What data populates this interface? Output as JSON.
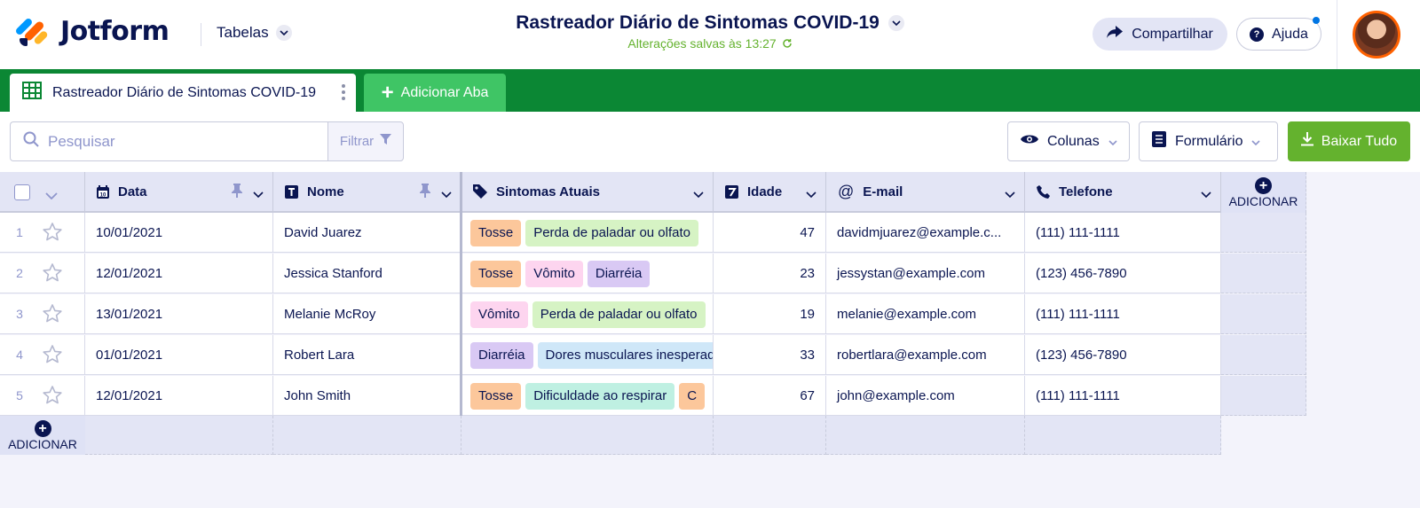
{
  "app": {
    "brand": "Jotform",
    "tables_label": "Tabelas"
  },
  "document": {
    "title": "Rastreador Diário de Sintomas COVID-19",
    "saved_status": "Alterações salvas às 13:27"
  },
  "header_actions": {
    "share_label": "Compartilhar",
    "help_label": "Ajuda"
  },
  "tabs": {
    "active_label": "Rastreador Diário de Sintomas COVID-19",
    "add_label": "Adicionar Aba"
  },
  "toolbar": {
    "search_placeholder": "Pesquisar",
    "filter_label": "Filtrar",
    "columns_label": "Colunas",
    "form_label": "Formulário",
    "download_label": "Baixar Tudo"
  },
  "columns": {
    "date": "Data",
    "name": "Nome",
    "symptoms": "Sintomas Atuais",
    "age": "Idade",
    "email": "E-mail",
    "phone": "Telefone",
    "add": "ADICIONAR"
  },
  "add_row_label": "ADICIONAR",
  "tag_colors": {
    "Tosse": "#fcc79b",
    "Perda de paladar ou olfato": "#d6f3c4",
    "Vômito": "#fdd5ef",
    "Diarréia": "#d9c9f4",
    "Dores musculares inesperadas": "#cfe7f8",
    "Dificuldade ao respirar": "#bff0e2"
  },
  "rows": [
    {
      "num": "1",
      "date": "10/01/2021",
      "name": "David Juarez",
      "symptoms": [
        "Tosse",
        "Perda de paladar ou olfato"
      ],
      "age": "47",
      "email": "davidmjuarez@example.c...",
      "phone": "(111) 111-1111"
    },
    {
      "num": "2",
      "date": "12/01/2021",
      "name": "Jessica Stanford",
      "symptoms": [
        "Tosse",
        "Vômito",
        "Diarréia"
      ],
      "age": "23",
      "email": "jessystan@example.com",
      "phone": "(123) 456-7890"
    },
    {
      "num": "3",
      "date": "13/01/2021",
      "name": "Melanie McRoy",
      "symptoms": [
        "Vômito",
        "Perda de paladar ou olfato"
      ],
      "age": "19",
      "email": "melanie@example.com",
      "phone": "(111) 111-1111"
    },
    {
      "num": "4",
      "date": "01/01/2021",
      "name": "Robert Lara",
      "symptoms": [
        "Diarréia",
        "Dores musculares inesperadas"
      ],
      "age": "33",
      "email": "robertlara@example.com",
      "phone": "(123) 456-7890"
    },
    {
      "num": "5",
      "date": "12/01/2021",
      "name": "John Smith",
      "symptoms": [
        "Tosse",
        "Dificuldade ao respirar",
        "C"
      ],
      "age": "67",
      "email": "john@example.com",
      "phone": "(111) 111-1111"
    }
  ]
}
